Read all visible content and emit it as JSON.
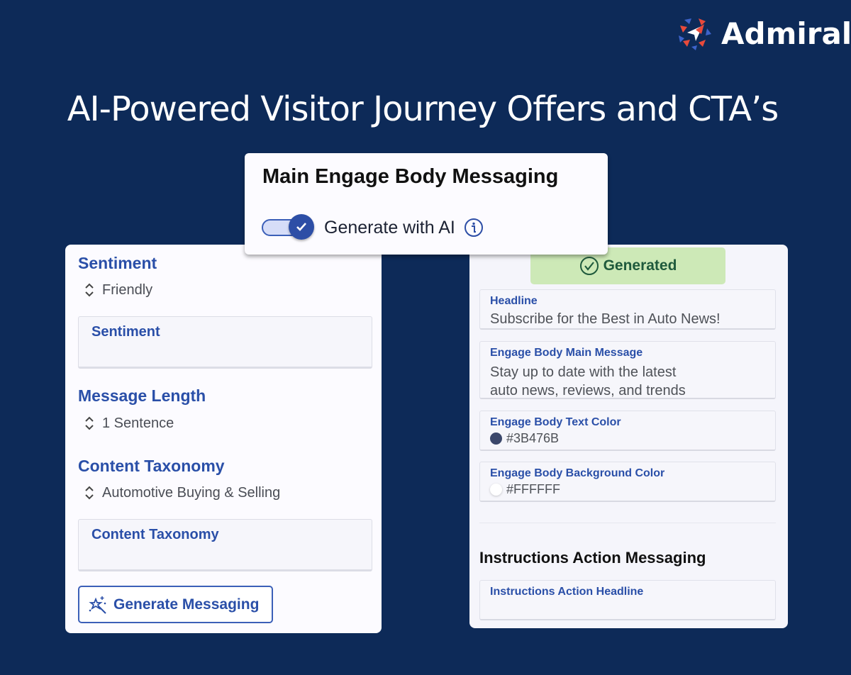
{
  "brand": {
    "name": "Admiral",
    "accent_red": "#e84a3b",
    "accent_blue": "#3d63c9"
  },
  "headline": "AI-Powered Visitor Journey Offers and CTA’s",
  "floating_card": {
    "title": "Main Engage Body Messaging",
    "toggle": {
      "label": "Generate with AI",
      "checked": true,
      "icon": "info-icon"
    }
  },
  "left_panel": {
    "sentiment": {
      "title": "Sentiment",
      "selected": "Friendly",
      "field_label": "Sentiment",
      "field_value": ""
    },
    "message_length": {
      "title": "Message Length",
      "selected": "1 Sentence"
    },
    "content_taxonomy": {
      "title": "Content Taxonomy",
      "selected": "Automotive Buying & Selling",
      "field_label": "Content Taxonomy",
      "field_value": ""
    },
    "generate_button": {
      "label": "Generate Messaging",
      "icon": "magic-wand-icon"
    }
  },
  "right_panel": {
    "status_badge": {
      "label": "Generated",
      "icon": "check-circle-icon",
      "color": "#cde9b7"
    },
    "fields": {
      "headline": {
        "label": "Headline",
        "value": "Subscribe for the Best in Auto News!"
      },
      "main_message": {
        "label": "Engage Body Main Message",
        "value_line1": "Stay up to date with the latest",
        "value_line2": "auto news, reviews, and trends"
      },
      "text_color": {
        "label": "Engage Body Text Color",
        "value": "#3B476B",
        "swatch": "#3B476B"
      },
      "background_color": {
        "label": "Engage Body Background Color",
        "value": "#FFFFFF",
        "swatch": "#FFFFFF"
      }
    },
    "instructions": {
      "heading": "Instructions Action Messaging",
      "headline_field": {
        "label": "Instructions Action Headline",
        "value": ""
      }
    }
  }
}
